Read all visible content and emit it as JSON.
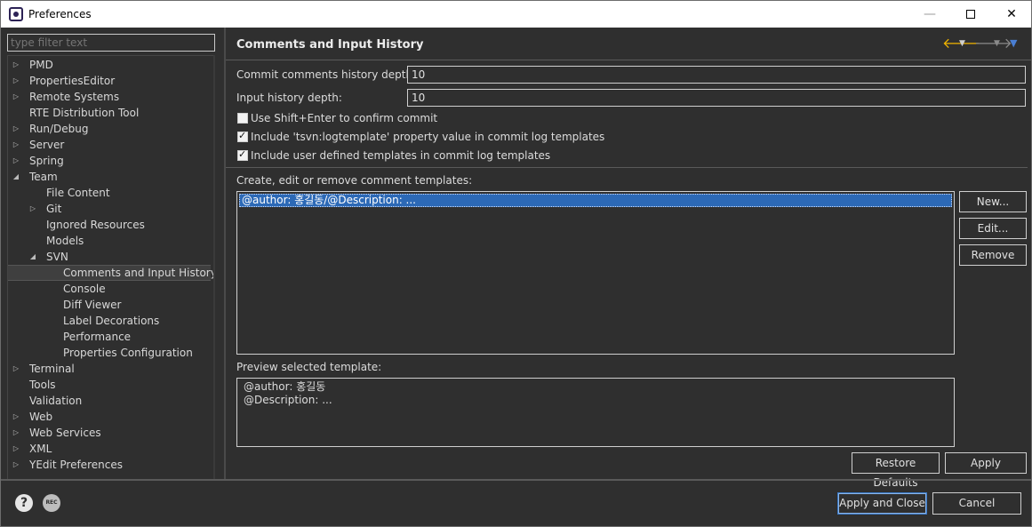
{
  "window": {
    "title": "Preferences",
    "minimize": "—",
    "close": "✕"
  },
  "filter": {
    "placeholder": "type filter text"
  },
  "tree": [
    {
      "label": "PMD",
      "expander": "closed"
    },
    {
      "label": "PropertiesEditor",
      "expander": "closed"
    },
    {
      "label": "Remote Systems",
      "expander": "closed"
    },
    {
      "label": "RTE Distribution Tool",
      "expander": "none"
    },
    {
      "label": "Run/Debug",
      "expander": "closed"
    },
    {
      "label": "Server",
      "expander": "closed"
    },
    {
      "label": "Spring",
      "expander": "closed"
    },
    {
      "label": "Team",
      "expander": "open"
    },
    {
      "label": "File Content",
      "expander": "none"
    },
    {
      "label": "Git",
      "expander": "closed"
    },
    {
      "label": "Ignored Resources",
      "expander": "none"
    },
    {
      "label": "Models",
      "expander": "none"
    },
    {
      "label": "SVN",
      "expander": "open"
    },
    {
      "label": "Comments and Input History",
      "expander": "none",
      "selected": true
    },
    {
      "label": "Console",
      "expander": "none"
    },
    {
      "label": "Diff Viewer",
      "expander": "none"
    },
    {
      "label": "Label Decorations",
      "expander": "none"
    },
    {
      "label": "Performance",
      "expander": "none"
    },
    {
      "label": "Properties Configuration",
      "expander": "none"
    },
    {
      "label": "Terminal",
      "expander": "closed"
    },
    {
      "label": "Tools",
      "expander": "none"
    },
    {
      "label": "Validation",
      "expander": "none"
    },
    {
      "label": "Web",
      "expander": "closed"
    },
    {
      "label": "Web Services",
      "expander": "closed"
    },
    {
      "label": "XML",
      "expander": "closed"
    },
    {
      "label": "YEdit Preferences",
      "expander": "closed"
    }
  ],
  "page": {
    "title": "Comments and Input History",
    "commit_depth_label": "Commit comments history depth:",
    "commit_depth_value": "10",
    "input_depth_label": "Input history depth:",
    "input_depth_value": "10",
    "checkboxes": [
      {
        "label": "Use Shift+Enter to confirm commit",
        "checked": false
      },
      {
        "label": "Include 'tsvn:logtemplate' property value in commit log templates",
        "checked": true
      },
      {
        "label": "Include user defined templates in commit log templates",
        "checked": true
      }
    ],
    "templates_label": "Create, edit or remove comment templates:",
    "templates": [
      "@author: 홍길동/@Description: ..."
    ],
    "new_button": "New...",
    "edit_button": "Edit...",
    "remove_button": "Remove",
    "preview_label": "Preview selected template:",
    "preview_lines": [
      "@author: 홍길동",
      "@Description: ..."
    ],
    "restore_defaults_button": "Restore Defaults",
    "apply_button": "Apply"
  },
  "footer": {
    "rec_label": "REC",
    "help_label": "?",
    "apply_close_button": "Apply and Close",
    "cancel_button": "Cancel"
  },
  "colors": {
    "background": "#2f2f2f",
    "selection": "#2c69b6",
    "back_arrow": "#f0b400",
    "nav_menu": "#4a7fd4"
  }
}
